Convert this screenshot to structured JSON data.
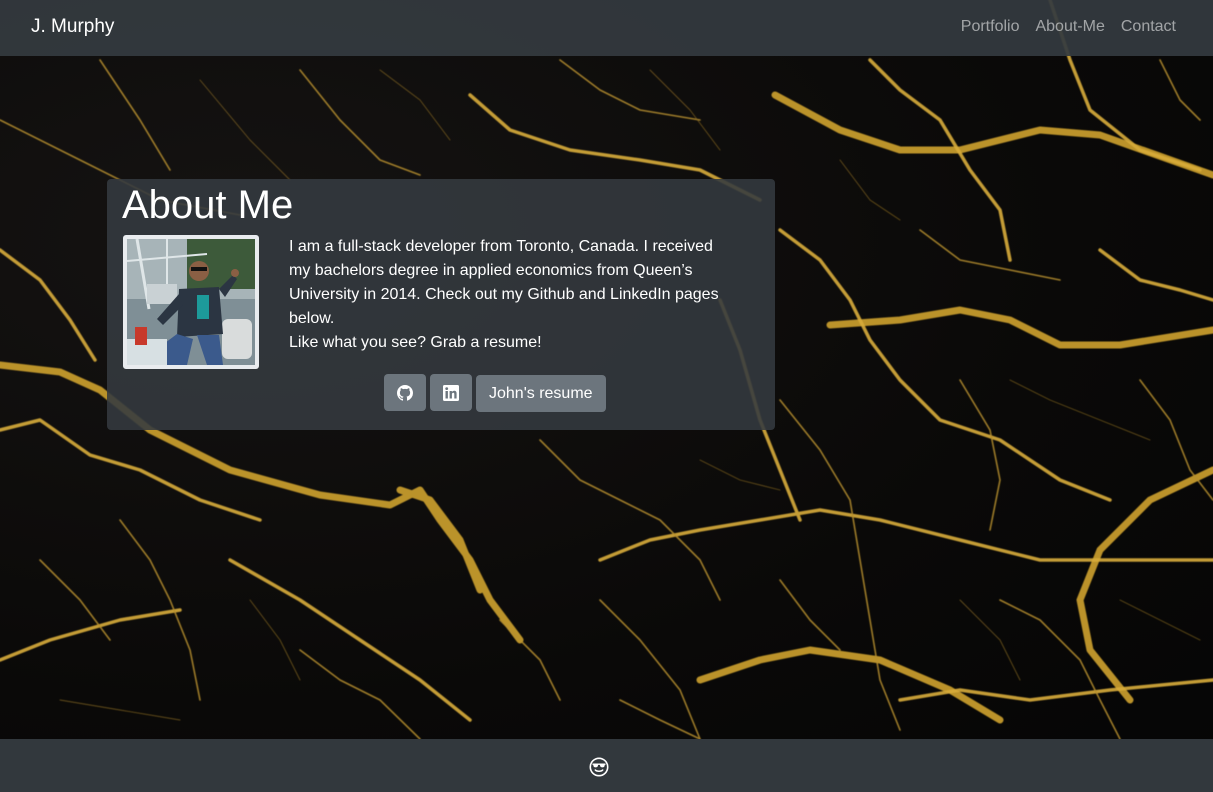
{
  "navbar": {
    "brand": "J. Murphy",
    "links": [
      "Portfolio",
      "About-Me",
      "Contact"
    ]
  },
  "about": {
    "title": "About Me",
    "photo_icon": "profile-photo",
    "bio_lines": [
      "I am a full-stack developer from Toronto, Canada. I received my bachelors degree in applied economics from Queen’s University in 2014. Check out my Github and LinkedIn pages below.",
      "Like what you see? Grab a resume!"
    ],
    "buttons": {
      "github_icon": "github-icon",
      "linkedin_icon": "linkedin-icon",
      "resume_label": "John's resume"
    }
  },
  "footer": {
    "icon": "sunglasses-smiley-icon"
  },
  "colors": {
    "navbar": "#343a40",
    "button": "#6c757d",
    "gold": "#c99a2e"
  }
}
